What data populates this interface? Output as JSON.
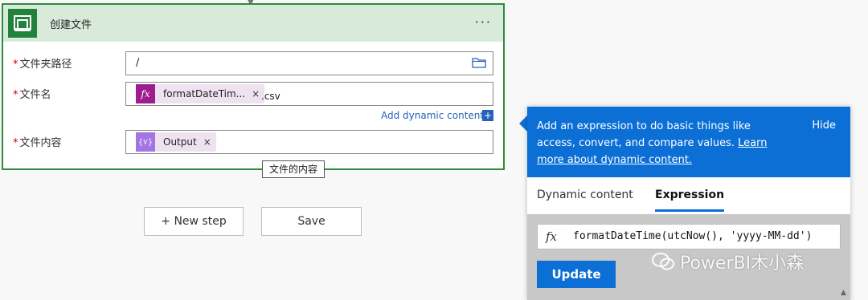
{
  "card": {
    "title": "创建文件",
    "more": "···",
    "fields": {
      "folder": {
        "label": "文件夹路径",
        "value": "/"
      },
      "filename": {
        "label": "文件名",
        "token_text": "formatDateTim...",
        "token_close": "×",
        "suffix": ".csv"
      },
      "content": {
        "label": "文件内容",
        "token_text": "Output",
        "token_close": "×"
      }
    },
    "required_mark": "*",
    "add_dynamic": "Add dynamic content",
    "add_dynamic_plus": "+",
    "tooltip": "文件的内容"
  },
  "buttons": {
    "new_step": "+ New step",
    "save": "Save"
  },
  "panel": {
    "info_text": "Add an expression to do basic things like access, convert, and compare values.",
    "info_link": "Learn more about dynamic content.",
    "hide": "Hide",
    "tabs": [
      {
        "label": "Dynamic content"
      },
      {
        "label": "Expression"
      }
    ],
    "expression": "formatDateTime(utcNow(), 'yyyy-MM-dd')",
    "fx": "fx",
    "update": "Update"
  },
  "watermark": "PowerBI木小森",
  "colors": {
    "accent": "#0c6fd6",
    "card_border": "#2f8a3b",
    "header_bg": "#d8ebdb",
    "fx_token": "#9b1d8e",
    "var_token": "#a274e4"
  }
}
